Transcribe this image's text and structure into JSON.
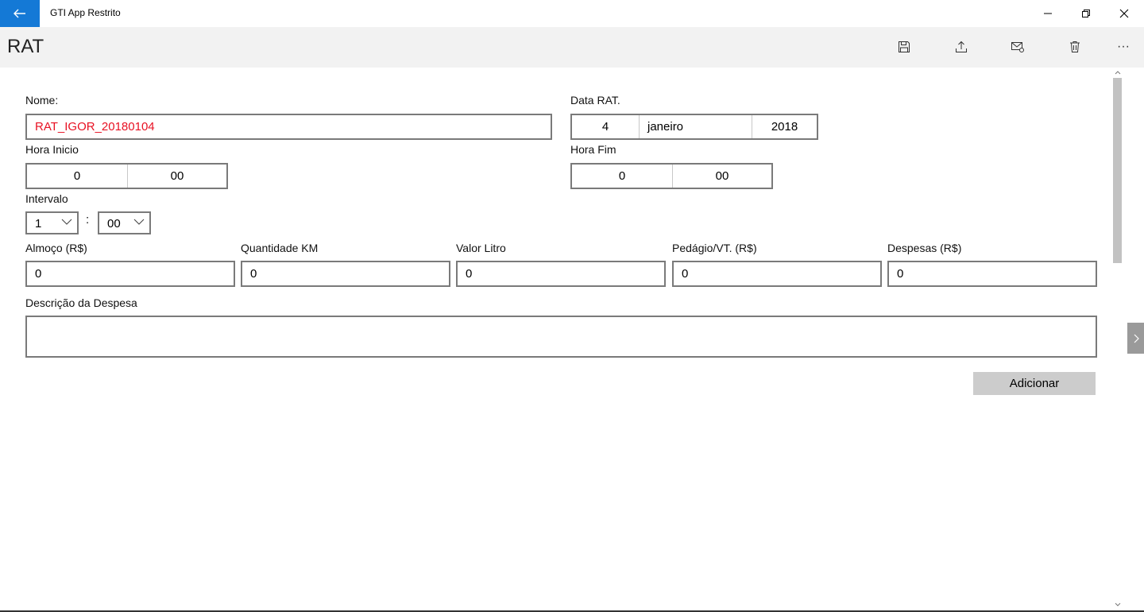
{
  "window": {
    "app_title": "GTI App Restrito",
    "back_icon": "back-arrow-icon",
    "accent_color": "#1479d6"
  },
  "commandbar": {
    "page_title": "RAT",
    "icons": [
      "save-icon",
      "share-icon",
      "mail-icon",
      "delete-icon",
      "more-icon"
    ],
    "more_label": "···"
  },
  "form": {
    "nome": {
      "label": "Nome:",
      "value": "RAT_IGOR_20180104",
      "value_color": "#e81123"
    },
    "data_rat": {
      "label": "Data RAT.",
      "day": "4",
      "month": "janeiro",
      "year": "2018"
    },
    "hora_inicio": {
      "label": "Hora Inicio",
      "hour": "0",
      "minute": "00"
    },
    "hora_fim": {
      "label": "Hora Fim",
      "hour": "0",
      "minute": "00"
    },
    "intervalo": {
      "label": "Intervalo",
      "hours": "1",
      "separator": ":",
      "minutes": "00"
    },
    "almoco": {
      "label": "Almoço (R$)",
      "value": "0"
    },
    "quantidade_km": {
      "label": "Quantidade KM",
      "value": "0"
    },
    "valor_litro": {
      "label": "Valor Litro",
      "value": "0"
    },
    "pedagio": {
      "label": "Pedágio/VT. (R$)",
      "value": "0"
    },
    "despesas": {
      "label": "Despesas (R$)",
      "value": "0"
    },
    "descricao": {
      "label": "Descrição da Despesa",
      "value": ""
    },
    "add_button": "Adicionar"
  }
}
